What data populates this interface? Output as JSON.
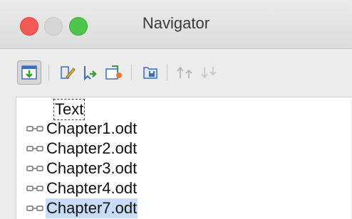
{
  "window": {
    "title": "Navigator"
  },
  "toolbar": {
    "buttons": [
      {
        "name": "toggle-icon",
        "active": true
      },
      {
        "name": "edit-icon"
      },
      {
        "name": "insert-icon"
      },
      {
        "name": "new-document-icon"
      },
      {
        "name": "save-as-icon"
      },
      {
        "name": "move-up-icon"
      },
      {
        "name": "move-down-icon"
      }
    ]
  },
  "tree": {
    "text_item": "Text",
    "items": [
      {
        "label": "Chapter1.odt"
      },
      {
        "label": "Chapter2.odt"
      },
      {
        "label": "Chapter3.odt"
      },
      {
        "label": "Chapter4.odt"
      },
      {
        "label": "Chapter7.odt",
        "selected": true
      }
    ]
  },
  "colors": {
    "selection": "#c9dcf7",
    "accent_green": "#3d9b3d",
    "accent_blue": "#3b6fbe"
  }
}
